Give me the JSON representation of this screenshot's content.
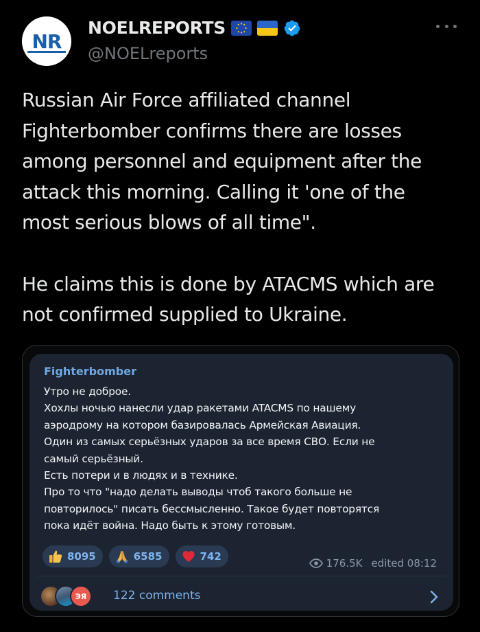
{
  "post": {
    "display_name": "NOELREPORTS",
    "handle": "@NOELreports",
    "avatar_text": "NR",
    "text": "Russian Air Force affiliated channel\nFighterbomber confirms there are losses\namong personnel and equipment after the\nattack this morning. Calling it 'one of the\nmost serious blows of all time\".\n\nHe claims this is done by ATACMS which are\nnot confirmed supplied to Ukraine.",
    "icons": [
      "eu-flag-icon",
      "ukraine-flag-icon",
      "verified-badge-icon",
      "more-options-icon"
    ]
  },
  "embedded_message": {
    "channel_name": "Fighterbomber",
    "text": "Утро не доброе.\nХохлы ночью нанесли удар ракетами ATACMS по нашему\nаэродрому на котором базировалась Армейская Авиация.\nОдин из самых серьёзных ударов за все время СВО. Если не\nсамый серьёзный.\nЕсть потери и в людях и в технике.\nПро то что \"надо делать выводы чтоб такого больше не\nповторилось\" писать  бессмысленно. Такое будет повторятся\nпока идёт война. Надо быть к этому готовым.",
    "reactions": [
      {
        "emoji": "thumbs-up-icon",
        "count": "8095"
      },
      {
        "emoji": "praying-hands-icon",
        "count": "6585"
      },
      {
        "emoji": "red-heart-icon",
        "count": "742"
      }
    ],
    "views": "176.5K",
    "edited": "edited 08:12",
    "comments_label": "122 comments",
    "comment_avatar_text": "ЭЯ"
  },
  "colors": {
    "background": "#000000",
    "text_primary": "#e7e9ea",
    "text_secondary": "#71767b",
    "verified_blue": "#1d9bf0",
    "bubble_bg": "#1c2431",
    "telegram_link": "#71a8e3"
  }
}
